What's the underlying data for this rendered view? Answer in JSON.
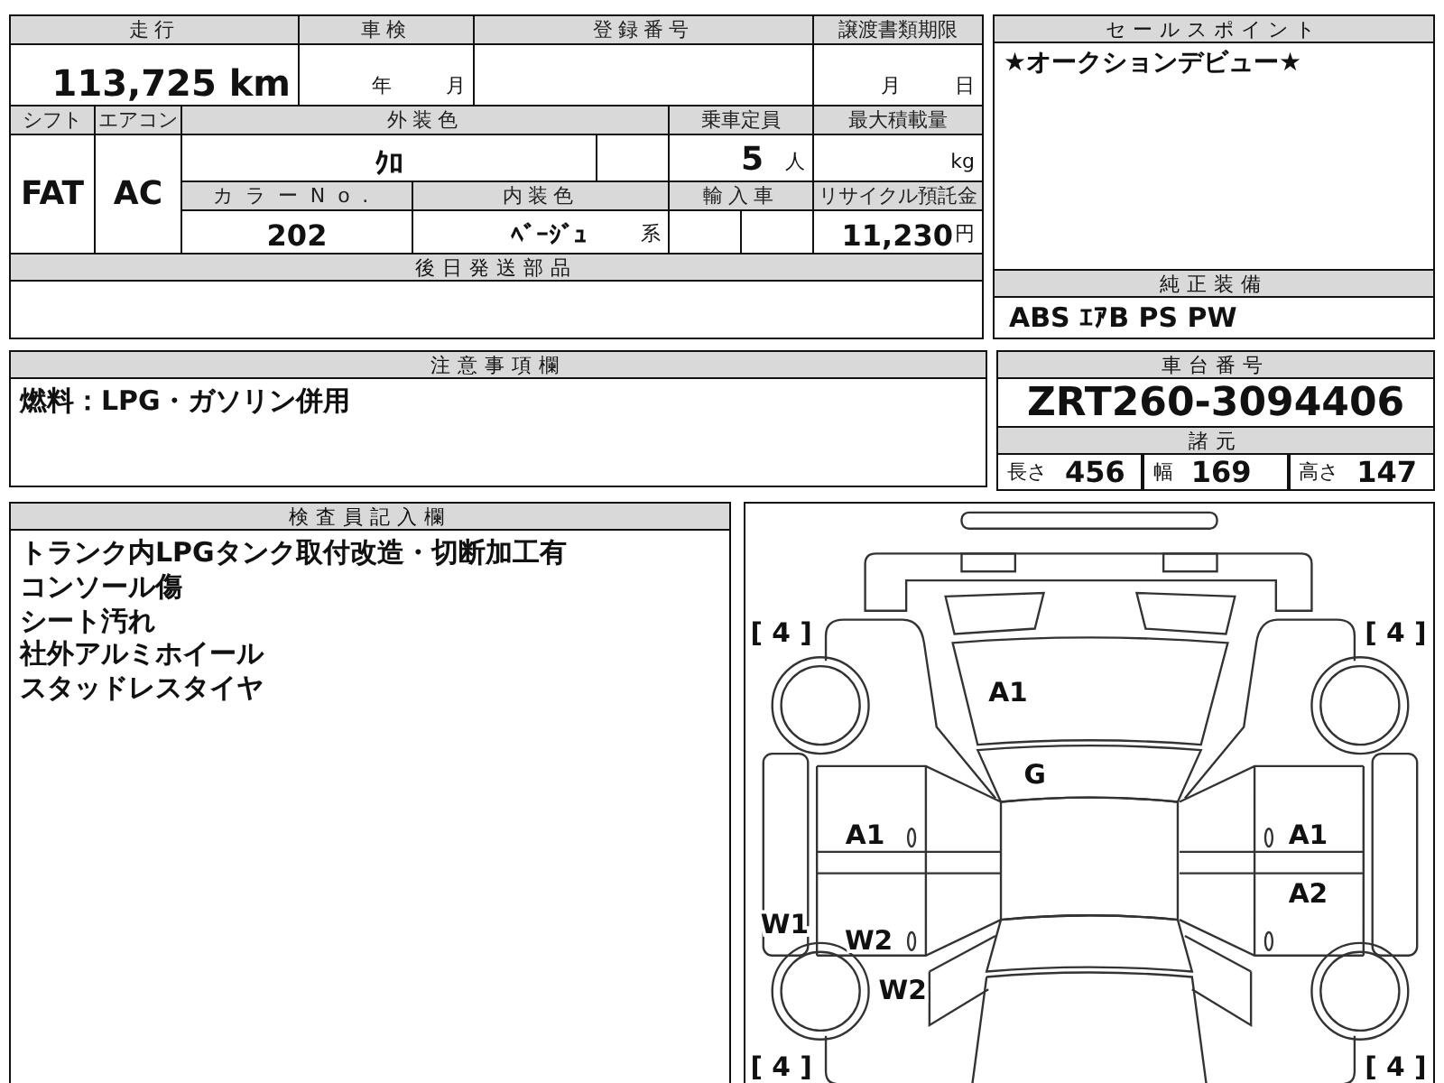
{
  "mileage": {
    "label": "走行",
    "value": "113,725 km"
  },
  "inspection": {
    "label": "車検",
    "year_unit": "年",
    "month_unit": "月"
  },
  "registration_number": {
    "label": "登録番号"
  },
  "transfer_deadline": {
    "label": "譲渡書類期限",
    "month_unit": "月",
    "day_unit": "日"
  },
  "shift": {
    "label": "シフト",
    "value": "FAT"
  },
  "aircon": {
    "label": "エアコン",
    "value": "AC"
  },
  "exterior_color": {
    "label": "外装色",
    "value": "ｸﾛ"
  },
  "capacity": {
    "label": "乗車定員",
    "value": "5",
    "unit": "人"
  },
  "max_load": {
    "label": "最大積載量",
    "unit": "kg"
  },
  "color_no": {
    "label": "カラーNo.",
    "value": "202"
  },
  "interior_color": {
    "label": "内装色",
    "value": "ﾍﾞｰｼﾞｭ",
    "suffix": "系"
  },
  "import_car": {
    "label": "輸入車"
  },
  "recycle_fee": {
    "label": "リサイクル預託金",
    "value": "11,230",
    "unit": "円"
  },
  "later_parts": {
    "label": "後日発送部品"
  },
  "sales_point": {
    "label": "セールスポイント",
    "text": "★オークションデビュー★"
  },
  "equipment": {
    "label": "純正装備",
    "text": "ABS ｴｱB PS PW"
  },
  "notes": {
    "label": "注意事項欄",
    "text": "燃料：LPG・ガソリン併用"
  },
  "chassis": {
    "label": "車台番号",
    "value": "ZRT260-3094406",
    "specs_label": "諸元",
    "specs": [
      {
        "label": "長さ",
        "value": "456"
      },
      {
        "label": "幅",
        "value": "169"
      },
      {
        "label": "高さ",
        "value": "147"
      }
    ]
  },
  "inspector": {
    "label": "検査員記入欄",
    "lines": [
      "トランク内LPGタンク取付改造・切断加工有",
      "コンソール傷",
      "シート汚れ",
      "社外アルミホイール",
      "スタッドレスタイヤ"
    ]
  },
  "diagram": {
    "tires": [
      {
        "text": "[ 4 ]"
      },
      {
        "text": "[ 4 ]"
      },
      {
        "text": "[ 4 ]"
      },
      {
        "text": "[ 4 ]"
      }
    ],
    "marks": [
      {
        "text": "A1"
      },
      {
        "text": "G"
      },
      {
        "text": "A1"
      },
      {
        "text": "A1"
      },
      {
        "text": "A2"
      },
      {
        "text": "W1"
      },
      {
        "text": "W2"
      },
      {
        "text": "W2"
      }
    ]
  }
}
